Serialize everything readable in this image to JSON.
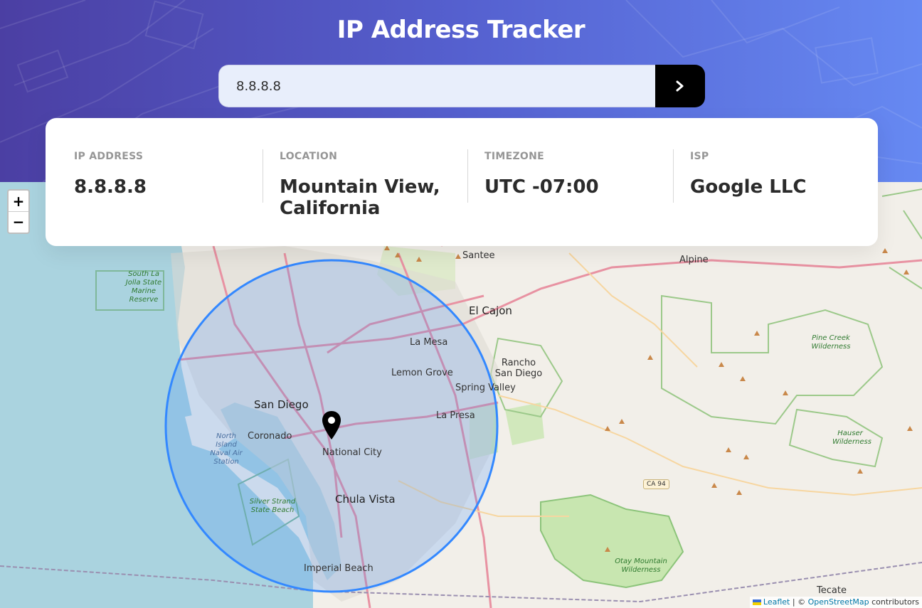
{
  "header": {
    "title": "IP Address Tracker",
    "search": {
      "value": "8.8.8.8",
      "submit_icon": "chevron-right-icon"
    }
  },
  "info": {
    "ip": {
      "label": "IP ADDRESS",
      "value": "8.8.8.8"
    },
    "location": {
      "label": "LOCATION",
      "value": "Mountain View, California"
    },
    "timezone": {
      "label": "TIMEZONE",
      "value": "UTC -07:00"
    },
    "isp": {
      "label": "ISP",
      "value": "Google LLC"
    }
  },
  "map": {
    "zoom_in": "+",
    "zoom_out": "−",
    "attribution": {
      "leaflet": "Leaflet",
      "separator": " | © ",
      "osm": "OpenStreetMap",
      "contributors": " contributors"
    },
    "labels": {
      "santee": "Santee",
      "alpine": "Alpine",
      "el_cajon": "El Cajon",
      "la_mesa": "La Mesa",
      "rancho_san_diego": "Rancho San Diego",
      "lemon_grove": "Lemon Grove",
      "spring_valley": "Spring Valley",
      "san_diego": "San Diego",
      "la_presa": "La Presa",
      "coronado": "Coronado",
      "national_city": "National City",
      "chula_vista": "Chula Vista",
      "imperial_beach": "Imperial Beach",
      "tecate": "Tecate",
      "south_la_jolla": "South La Jolla State Marine Reserve",
      "north_island": "North Island Naval Air Station",
      "silver_strand": "Silver Strand State Beach",
      "pine_creek": "Pine Creek Wilderness",
      "hauser_creek": "Hauser Wilderness",
      "otay_mountain": "Otay Mountain Wilderness",
      "ca94": "CA 94"
    },
    "colors": {
      "ocean": "#aad3df",
      "land": "#f2efe9",
      "park": "#c8e6b0",
      "circle": "#3388ff"
    }
  }
}
